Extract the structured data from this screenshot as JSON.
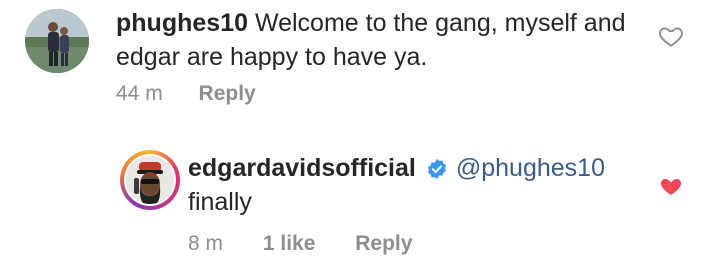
{
  "comment": {
    "username": "phughes10",
    "text": "Welcome to the gang, myself and edgar are happy to have ya.",
    "time": "44 m",
    "reply_label": "Reply",
    "like_icon": "heart-outline-icon"
  },
  "reply": {
    "username": "edgardavidsofficial",
    "verified_icon": "verified-badge-icon",
    "mention": "@phughes10",
    "text": "finally",
    "time": "8 m",
    "likes": "1 like",
    "reply_label": "Reply",
    "like_icon": "heart-filled-icon",
    "liked_color": "#ed4956"
  }
}
